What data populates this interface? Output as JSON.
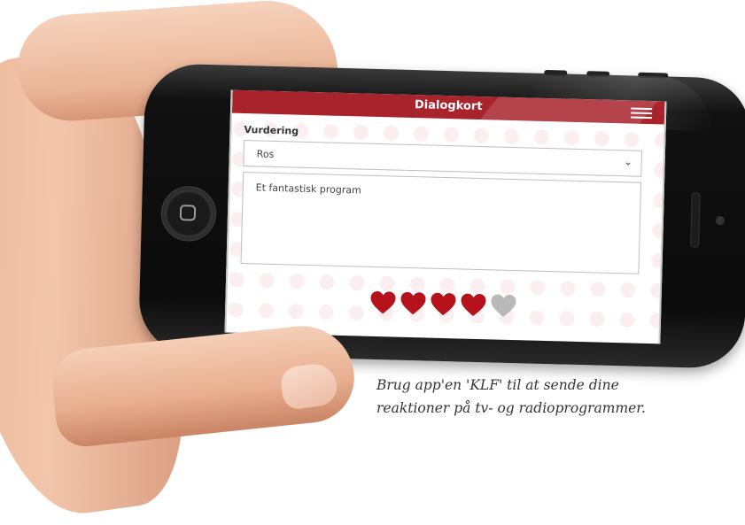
{
  "app": {
    "title": "Dialogkort",
    "menu_icon": "hamburger-menu-icon"
  },
  "form": {
    "rating_label": "Vurdering",
    "select_value": "Ros",
    "select_icon": "double-chevron-down-icon",
    "comment_value": "Et fantastisk program"
  },
  "rating": {
    "value": 4,
    "max": 5,
    "icon": "heart-icon",
    "filled_color": "#b5121b",
    "empty_color": "#b9b9b9"
  },
  "caption": {
    "line1": "Brug app'en 'KLF' til at sende dine",
    "line2": "reaktioner på tv- og radioprogrammer."
  },
  "colors": {
    "brand_red": "#a8232c"
  }
}
